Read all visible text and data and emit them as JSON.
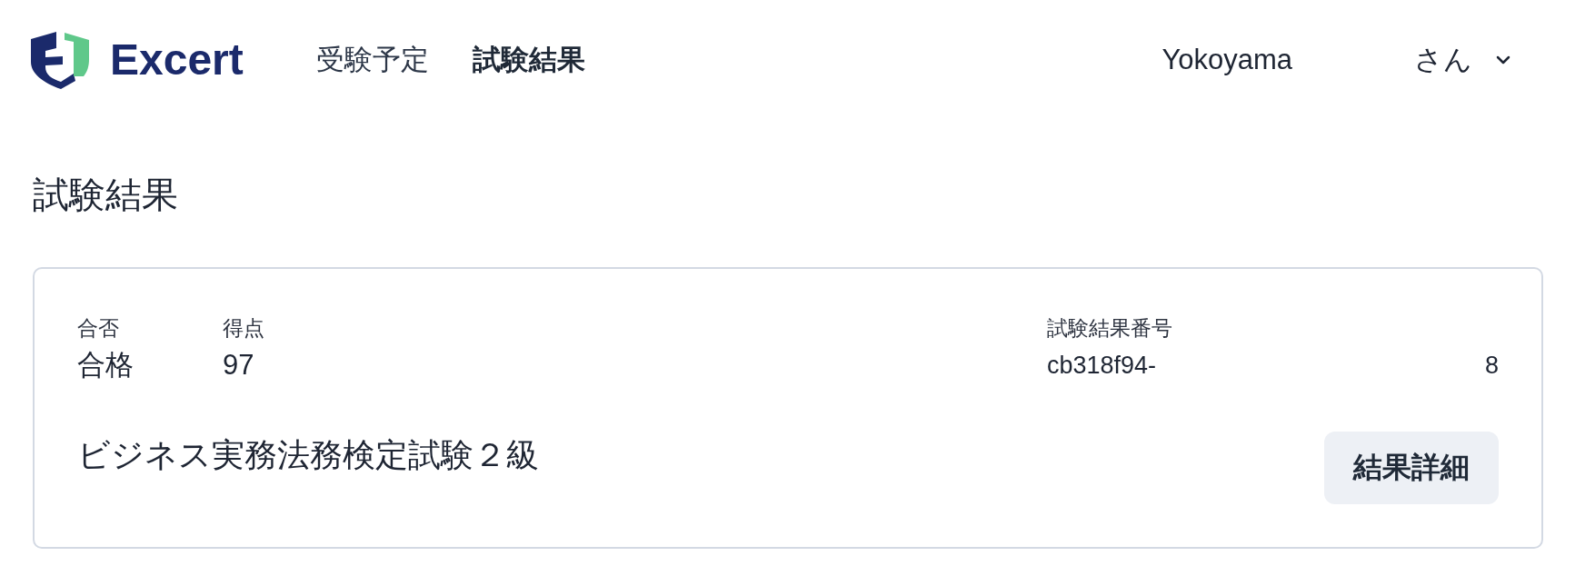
{
  "header": {
    "logo": {
      "text": "Excert"
    },
    "nav": [
      {
        "label": "受験予定",
        "selected": false
      },
      {
        "label": "試験結果",
        "selected": true
      }
    ],
    "user_menu": {
      "name": "Yokoyama",
      "honorific": "さん"
    }
  },
  "page_title": "試験結果",
  "results": [
    {
      "fields": [
        {
          "label": "合否",
          "value": "合格"
        },
        {
          "label": "得点",
          "value": "97"
        }
      ],
      "result_number": {
        "label": "試験結果番号",
        "value_parts": [
          "cb318f94-",
          "8"
        ]
      },
      "exam_name": "ビジネス実務法務検定試験２級",
      "detail_button": "結果詳細"
    }
  ]
}
